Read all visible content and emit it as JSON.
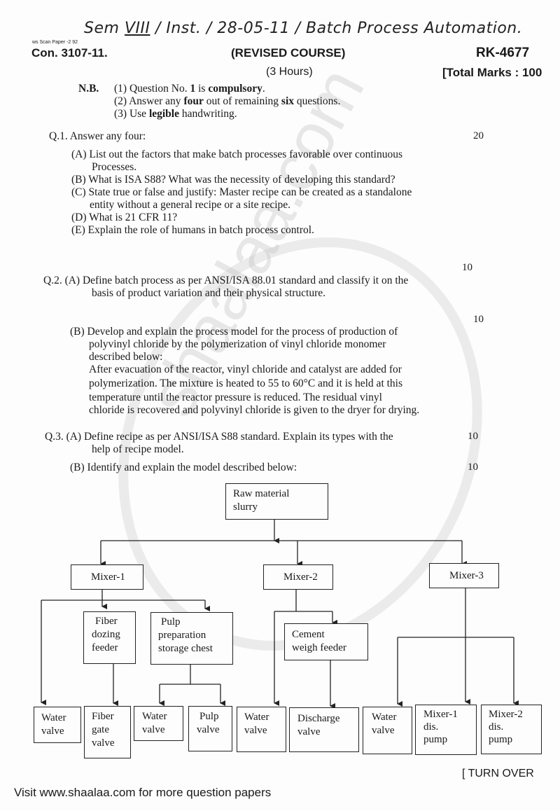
{
  "handwritten": {
    "sem_label": "Sem",
    "sem_value": "VIII",
    "dept": "Inst.",
    "date": "28-05-11",
    "subject": "Batch Process Automation."
  },
  "header": {
    "scan_note": "ws Scan Paper -2 92",
    "con": "Con. 3107-11.",
    "course": "(REVISED COURSE)",
    "code": "RK-4677",
    "duration": "(3 Hours)",
    "total_marks": "[Total Marks : 100"
  },
  "nb": {
    "label": "N.B.",
    "items": [
      {
        "pre": "(1) Question No. ",
        "b1": "1",
        "mid": " is ",
        "b2": "compulsory",
        "post": "."
      },
      {
        "pre": "(2)  Answer any ",
        "b1": "four",
        "mid": " out of remaining ",
        "b2": "six",
        "post": " questions."
      },
      {
        "pre": "(3)  Use ",
        "b1": "legible",
        "mid": " handwriting.",
        "b2": "",
        "post": ""
      }
    ]
  },
  "q1": {
    "title": "Q.1. Answer any four:",
    "marks": "20",
    "parts": [
      "(A) List out the factors that make batch processes favorable over continuous",
      "Processes.",
      "(B) What is ISA S88? What was the necessity of developing this standard?",
      "(C) State true or false and justify: Master recipe can be created as a standalone",
      "entity without a general recipe or a site recipe.",
      "(D) What is 21 CFR 11?",
      "(E) Explain the role of  humans in batch process control."
    ]
  },
  "q2": {
    "marks_a": "10",
    "a_line1": "Q.2. (A) Define batch process as per ANSI/ISA 88.01 standard and classify it on the",
    "a_line2": "basis of product variation and their physical structure.",
    "marks_b": "10",
    "b_lines": [
      "(B) Develop and explain the process model for the process of production of",
      "polyvinyl chloride by the polymerization of vinyl chloride monomer",
      "described below:",
      "After evacuation of the reactor, vinyl chloride and catalyst are added for",
      "polymerization. The mixture is heated to 55 to 60°C and it is held at this",
      "temperature until the reactor pressure is reduced. The residual vinyl",
      "chloride is recovered and polyvinyl chloride is given to the dryer for drying."
    ]
  },
  "q3": {
    "a_line1": "Q.3. (A) Define recipe as per ANSI/ISA S88 standard. Explain its types with the",
    "a_line2": "help of recipe model.",
    "marks_a": "10",
    "b_line": "(B) Identify and explain the model described below:",
    "marks_b": "10"
  },
  "diagram": {
    "root": [
      "Raw material",
      "slurry"
    ],
    "mixer1": "Mixer-1",
    "mixer2": "Mixer-2",
    "mixer3": "Mixer-3",
    "fiber_dozing": [
      "Fiber",
      "dozing",
      "feeder"
    ],
    "pulp_prep": [
      "Pulp",
      "preparation",
      "storage chest"
    ],
    "cement": [
      "Cement",
      "weigh feeder"
    ],
    "water_valve": [
      "Water",
      "valve"
    ],
    "fiber_gate": [
      "Fiber",
      "gate",
      "valve"
    ],
    "pulp_valve": [
      "Pulp",
      "valve"
    ],
    "discharge": [
      "Discharge",
      "valve"
    ],
    "m1_pump": [
      "Mixer-1",
      "dis.",
      "pump"
    ],
    "m2_pump": [
      "Mixer-2",
      "dis.",
      "pump"
    ]
  },
  "footer": {
    "turn_over": "[ TURN OVER",
    "visit": "Visit www.shaalaa.com for more question papers"
  }
}
